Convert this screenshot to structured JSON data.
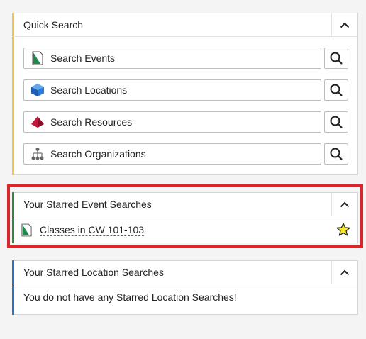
{
  "colors": {
    "quick_accent": "#f0c451",
    "event_accent": "#2e8b3e",
    "location_accent": "#2a72c9",
    "highlight": "#d9262b"
  },
  "quick_search": {
    "title": "Quick Search",
    "items": [
      {
        "label": "Search Events",
        "icon": "event-document-icon"
      },
      {
        "label": "Search Locations",
        "icon": "blue-cube-icon"
      },
      {
        "label": "Search Resources",
        "icon": "red-pyramid-icon"
      },
      {
        "label": "Search Organizations",
        "icon": "org-tree-icon"
      }
    ]
  },
  "starred_events": {
    "title": "Your Starred Event Searches",
    "items": [
      {
        "label": "Classes in CW 101-103",
        "icon": "event-document-icon",
        "starred": true
      }
    ]
  },
  "starred_locations": {
    "title": "Your Starred Location Searches",
    "empty_message": "You do not have any Starred Location Searches!"
  }
}
